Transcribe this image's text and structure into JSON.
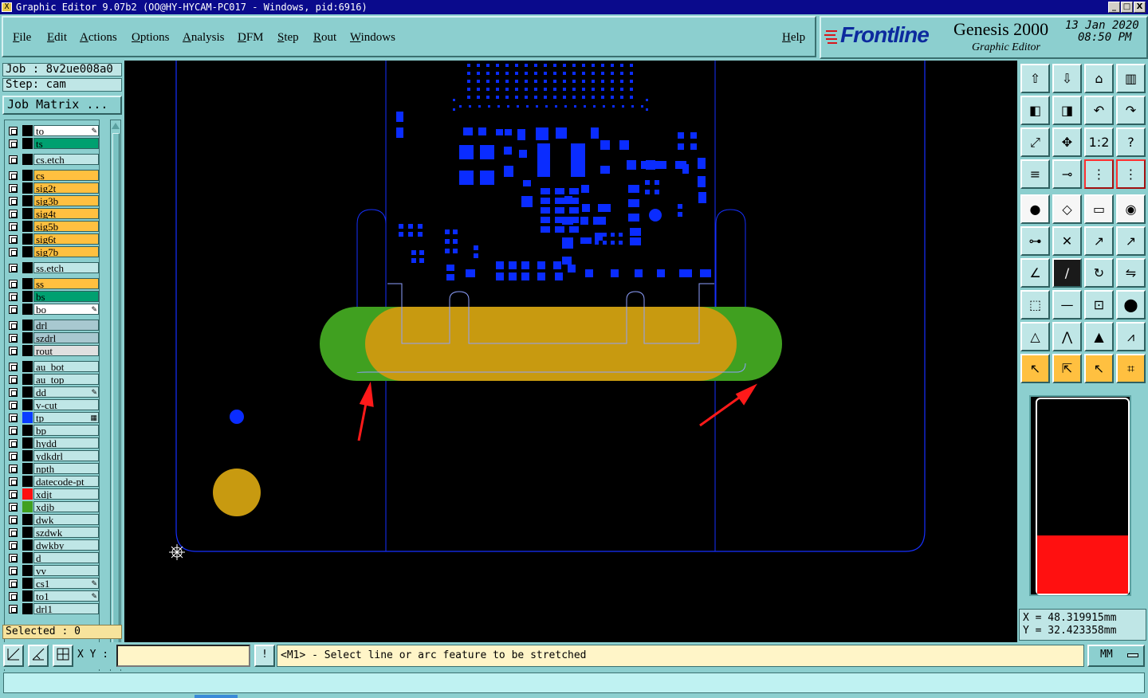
{
  "window": {
    "title": "Graphic Editor 9.07b2 (OO@HY-HYCAM-PC017 - Windows, pid:6916)",
    "minimize_label": "_",
    "maximize_label": "□",
    "close_label": "X"
  },
  "menu": [
    "File",
    "Edit",
    "Actions",
    "Options",
    "Analysis",
    "DFM",
    "Step",
    "Rout",
    "Windows"
  ],
  "help_label": "Help",
  "logo": {
    "brand": "Frontline",
    "product": "Genesis 2000",
    "subtitle": "Graphic Editor",
    "date": "13 Jan 2020",
    "time": "08:50 PM"
  },
  "job": {
    "job_label": "Job : 8v2ue008a0",
    "step_label": "Step: cam",
    "job_matrix_button": "Job Matrix ..."
  },
  "layers": [
    {
      "name": "to",
      "color": "#ffffff",
      "swatch": "#000000",
      "mark": "pen"
    },
    {
      "name": "ts",
      "color": "#00a070",
      "swatch": "#000000",
      "mark": ""
    },
    {
      "name": "cs.etch",
      "color": "#bfe6e6",
      "swatch": "#000000",
      "mark": ""
    },
    {
      "name": "cs",
      "color": "#ffc040",
      "swatch": "#000000",
      "mark": ""
    },
    {
      "name": "sig2t",
      "color": "#ffc040",
      "swatch": "#000000",
      "mark": ""
    },
    {
      "name": "sig3b",
      "color": "#ffc040",
      "swatch": "#000000",
      "mark": ""
    },
    {
      "name": "sig4t",
      "color": "#ffc040",
      "swatch": "#000000",
      "mark": ""
    },
    {
      "name": "sig5b",
      "color": "#ffc040",
      "swatch": "#000000",
      "mark": ""
    },
    {
      "name": "sig6t",
      "color": "#ffc040",
      "swatch": "#000000",
      "mark": ""
    },
    {
      "name": "sig7b",
      "color": "#ffc040",
      "swatch": "#000000",
      "mark": ""
    },
    {
      "name": "ss.etch",
      "color": "#bfe6e6",
      "swatch": "#000000",
      "mark": ""
    },
    {
      "name": "ss",
      "color": "#ffc040",
      "swatch": "#000000",
      "mark": ""
    },
    {
      "name": "bs",
      "color": "#00a070",
      "swatch": "#000000",
      "mark": ""
    },
    {
      "name": "bo",
      "color": "#ffffff",
      "swatch": "#000000",
      "mark": "pen"
    },
    {
      "name": "drl",
      "color": "#a8c8d0",
      "swatch": "#000000",
      "mark": ""
    },
    {
      "name": "szdrl",
      "color": "#a8c8d0",
      "swatch": "#000000",
      "mark": ""
    },
    {
      "name": "rout",
      "color": "#e0e0e0",
      "swatch": "#000000",
      "mark": ""
    },
    {
      "name": "au_bot",
      "color": "#bfe6e6",
      "swatch": "#000000",
      "mark": ""
    },
    {
      "name": "au_top",
      "color": "#bfe6e6",
      "swatch": "#000000",
      "mark": ""
    },
    {
      "name": "dd",
      "color": "#bfe6e6",
      "swatch": "#000000",
      "mark": "pen"
    },
    {
      "name": "v-cut",
      "color": "#bfe6e6",
      "swatch": "#000000",
      "mark": ""
    },
    {
      "name": "tp",
      "color": "#bfe6e6",
      "swatch": "#0a3cff",
      "mark": "grid"
    },
    {
      "name": "bp",
      "color": "#bfe6e6",
      "swatch": "#000000",
      "mark": ""
    },
    {
      "name": "hydd",
      "color": "#bfe6e6",
      "swatch": "#000000",
      "mark": ""
    },
    {
      "name": "ydkdrl",
      "color": "#bfe6e6",
      "swatch": "#000000",
      "mark": ""
    },
    {
      "name": "npth",
      "color": "#bfe6e6",
      "swatch": "#000000",
      "mark": ""
    },
    {
      "name": "datecode-pt",
      "color": "#bfe6e6",
      "swatch": "#000000",
      "mark": ""
    },
    {
      "name": "xdjt",
      "color": "#bfe6e6",
      "swatch": "#ff1010",
      "mark": ""
    },
    {
      "name": "xdjb",
      "color": "#bfe6e6",
      "swatch": "#40a020",
      "mark": ""
    },
    {
      "name": "dwk",
      "color": "#bfe6e6",
      "swatch": "#000000",
      "mark": ""
    },
    {
      "name": "szdwk",
      "color": "#bfe6e6",
      "swatch": "#000000",
      "mark": ""
    },
    {
      "name": "dwkby",
      "color": "#bfe6e6",
      "swatch": "#000000",
      "mark": ""
    },
    {
      "name": "d",
      "color": "#bfe6e6",
      "swatch": "#000000",
      "mark": ""
    },
    {
      "name": "vv",
      "color": "#bfe6e6",
      "swatch": "#000000",
      "mark": ""
    },
    {
      "name": "cs1",
      "color": "#bfe6e6",
      "swatch": "#000000",
      "mark": "pen"
    },
    {
      "name": "to1",
      "color": "#bfe6e6",
      "swatch": "#000000",
      "mark": "pen"
    },
    {
      "name": "drl1",
      "color": "#bfe6e6",
      "swatch": "#000000",
      "mark": ""
    }
  ],
  "selected_label": "Selected : 0",
  "coords": {
    "x_label": "X = 48.319915mm",
    "y_label": "Y = 32.423358mm"
  },
  "bottom": {
    "xy_label": "X Y :",
    "xy_value": "",
    "prompt": "<M1> - Select line or arc feature to be stretched",
    "units": "MM"
  },
  "toolbar_icons": [
    "zoom-home-icon",
    "zoom-window-icon",
    "home-icon",
    "pan-icon",
    "pan-left-icon",
    "pan-right-icon",
    "undo-zoom-icon",
    "redo-zoom-icon",
    "zoom-fit-icon",
    "center-icon",
    "one-to-one-icon",
    "query-icon",
    "measure-icon",
    "snap-icon",
    "layers-color-icon",
    "layers-compare-icon",
    "add-pad-icon",
    "add-line-icon",
    "ruler-icon",
    "circle-icon",
    "connect-icon",
    "cross-icon",
    "move-icon",
    "copy-icon",
    "angle-icon",
    "slash-icon",
    "rotate-icon",
    "mirror-icon",
    "resize-icon",
    "line-icon",
    "dimension-icon",
    "shapes-icon",
    "delta-icon",
    "arc-icon",
    "triangle-icon",
    "triangle-cut-icon",
    "select-icon",
    "select-box-icon",
    "select-edit-icon",
    "select-net-icon"
  ],
  "colors": {
    "panel": "#8ccfcf",
    "canvas": "#000000",
    "feature_blue": "#0a2cff",
    "green_layer": "#40a020",
    "gold_layer": "#c89a10",
    "arrow_red": "#ff1a1a",
    "histogram_fill": "#ff1010"
  },
  "histogram_fill_fraction": 0.3
}
